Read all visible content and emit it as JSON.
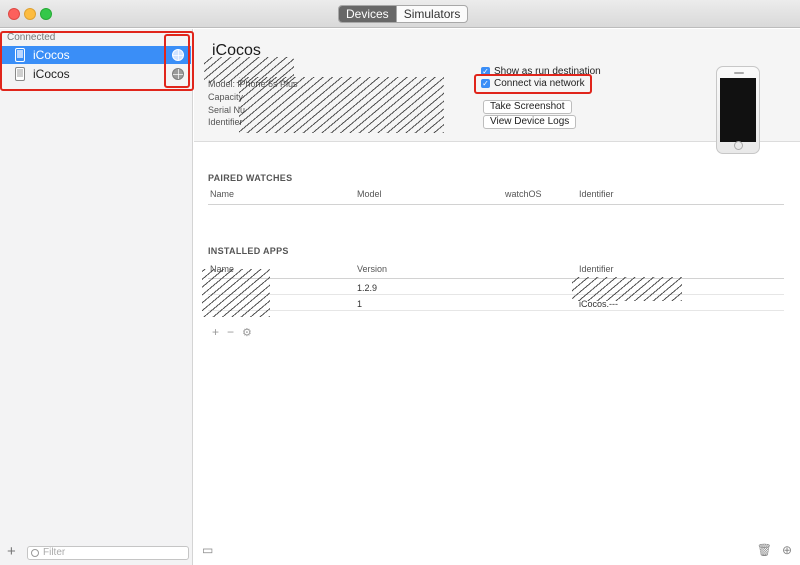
{
  "window": {
    "tabs": [
      {
        "label": "Devices",
        "active": true
      },
      {
        "label": "Simulators",
        "active": false
      }
    ]
  },
  "sidebar": {
    "section_label": "Connected",
    "devices": [
      {
        "name": "iCocos",
        "selected": true,
        "icon": "iphone-icon"
      },
      {
        "name": "iCocos",
        "selected": false,
        "icon": "iphone-icon"
      }
    ],
    "filter_placeholder": "Filter",
    "add_icon": "+"
  },
  "device": {
    "name": "iCocos",
    "model": "Model: iPhone 6s Plus",
    "capacity_label": "Capacity",
    "serial_label": "Serial Nu",
    "identifier_label": "Identifier",
    "show_as_run_destination": "Show as run destination",
    "connect_via_network": "Connect via network",
    "take_screenshot": "Take Screenshot",
    "view_device_logs": "View Device Logs"
  },
  "paired_watches": {
    "title": "PAIRED WATCHES",
    "columns": [
      "Name",
      "Model",
      "watchOS",
      "Identifier"
    ]
  },
  "installed_apps": {
    "title": "INSTALLED APPS",
    "columns": [
      "Name",
      "Version",
      "Identifier"
    ],
    "rows": [
      {
        "version": "1.2.9",
        "identifier": ""
      },
      {
        "version": "1",
        "identifier": "iCocos.---"
      }
    ]
  },
  "colors": {
    "selection": "#3a8ef7",
    "highlight_box": "#e0251b"
  }
}
